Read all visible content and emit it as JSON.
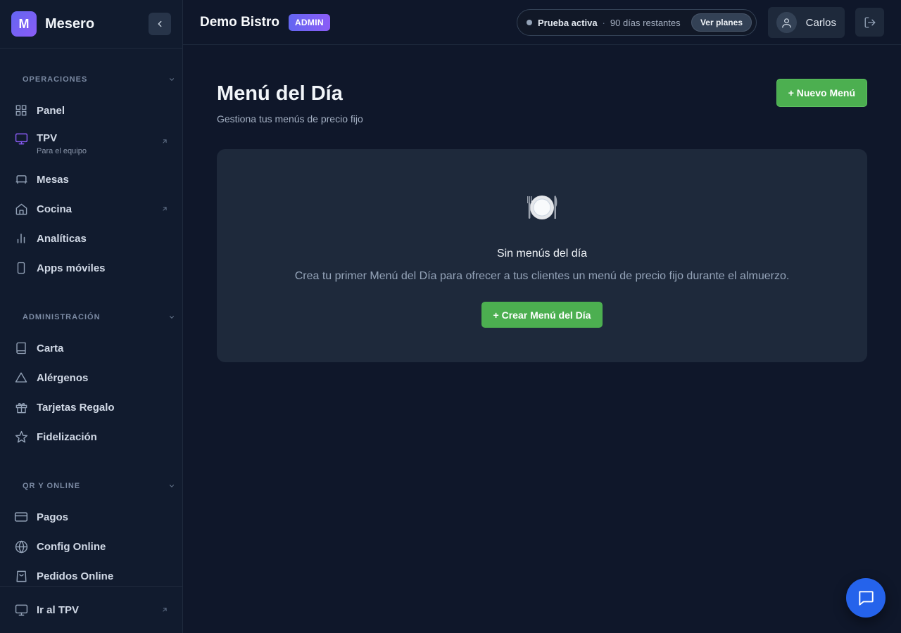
{
  "app": {
    "logo_letter": "M",
    "name": "Mesero"
  },
  "colors": {
    "accent": "#6366f1",
    "primary_button": "#4caf50",
    "chat_button": "#2563eb",
    "background": "#0f172a"
  },
  "sidebar": {
    "sections": [
      {
        "title": "OPERACIONES",
        "items": [
          {
            "label": "Panel",
            "icon": "grid-icon"
          },
          {
            "label": "TPV",
            "sublabel": "Para el equipo",
            "icon": "monitor-icon",
            "external": true
          },
          {
            "label": "Mesas",
            "icon": "table-icon"
          },
          {
            "label": "Cocina",
            "icon": "home-icon",
            "external": true
          },
          {
            "label": "Analíticas",
            "icon": "bar-chart-icon"
          },
          {
            "label": "Apps móviles",
            "icon": "smartphone-icon"
          }
        ]
      },
      {
        "title": "ADMINISTRACIÓN",
        "items": [
          {
            "label": "Carta",
            "icon": "book-icon"
          },
          {
            "label": "Alérgenos",
            "icon": "warning-icon"
          },
          {
            "label": "Tarjetas Regalo",
            "icon": "gift-icon"
          },
          {
            "label": "Fidelización",
            "icon": "star-icon"
          }
        ]
      },
      {
        "title": "QR Y ONLINE",
        "items": [
          {
            "label": "Pagos",
            "icon": "credit-card-icon"
          },
          {
            "label": "Config Online",
            "icon": "globe-icon"
          },
          {
            "label": "Pedidos Online",
            "icon": "shopping-bag-icon"
          }
        ]
      }
    ],
    "footer": {
      "label": "Ir al TPV",
      "icon": "monitor-icon"
    }
  },
  "topbar": {
    "restaurant": "Demo Bistro",
    "role": "ADMIN",
    "trial": {
      "status": "Prueba activa",
      "separator": "·",
      "days": "90 días restantes",
      "plans_label": "Ver planes"
    },
    "user": {
      "name": "Carlos"
    }
  },
  "main": {
    "title": "Menú del Día",
    "subtitle": "Gestiona tus menús de precio fijo",
    "new_button": "+ Nuevo Menú",
    "empty": {
      "icon": "plate-cutlery-icon",
      "title": "Sin menús del día",
      "description": "Crea tu primer Menú del Día para ofrecer a tus clientes un menú de precio fijo durante el almuerzo.",
      "create_button": "+ Crear Menú del Día"
    }
  }
}
